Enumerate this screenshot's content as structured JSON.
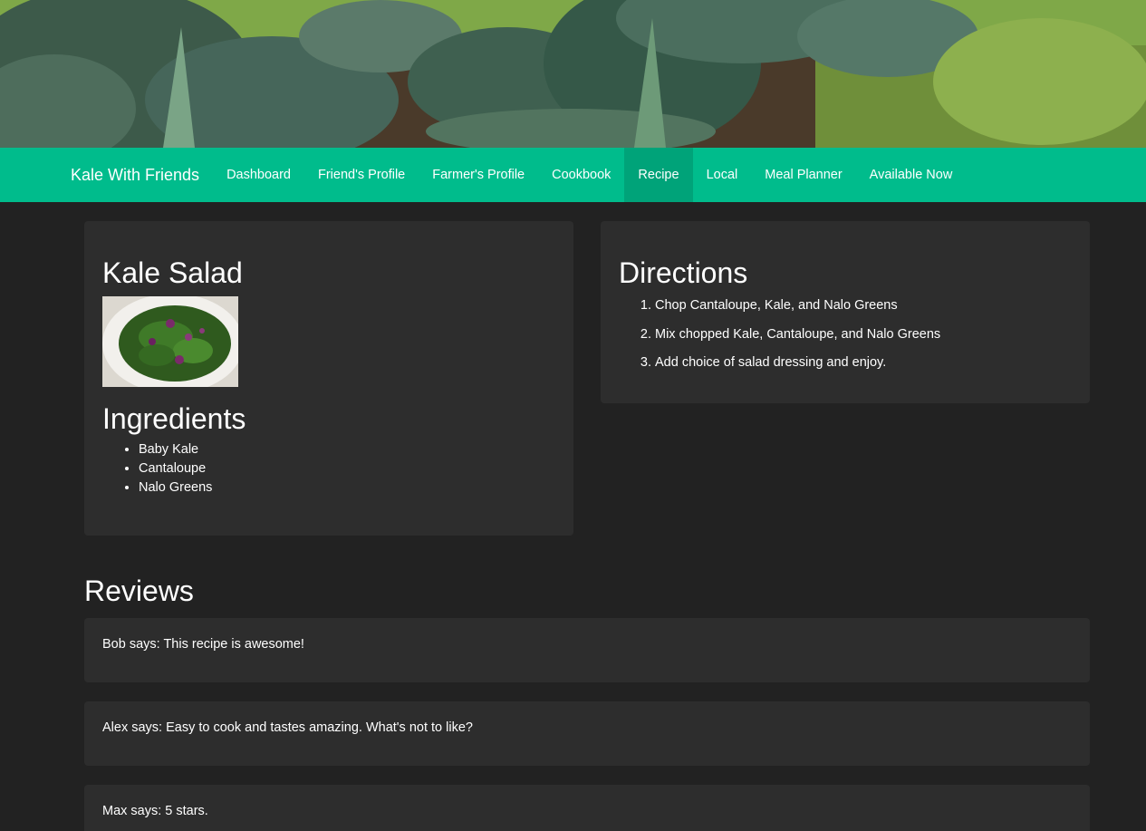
{
  "navbar": {
    "brand": "Kale With Friends",
    "items": [
      {
        "label": "Dashboard"
      },
      {
        "label": "Friend's Profile"
      },
      {
        "label": "Farmer's Profile"
      },
      {
        "label": "Cookbook"
      },
      {
        "label": "Recipe",
        "active": true
      },
      {
        "label": "Local"
      },
      {
        "label": "Meal Planner"
      },
      {
        "label": "Available Now"
      }
    ]
  },
  "recipe": {
    "title": "Kale Salad",
    "image_icon": "salad-photo",
    "ingredients_title": "Ingredients",
    "ingredients": [
      "Baby Kale",
      "Cantaloupe",
      "Nalo Greens"
    ]
  },
  "directions": {
    "title": "Directions",
    "steps": [
      "Chop Cantaloupe, Kale, and Nalo Greens",
      "Mix chopped Kale, Cantaloupe, and Nalo Greens",
      "Add choice of salad dressing and enjoy."
    ]
  },
  "reviews": {
    "title": "Reviews",
    "items": [
      "Bob says: This recipe is awesome!",
      "Alex says: Easy to cook and tastes amazing. What's not to like?",
      "Max says: 5 stars."
    ]
  },
  "colors": {
    "navbar": "#00bc8c",
    "navbar_active": "#00a379",
    "background": "#222222",
    "panel": "#2d2d2d"
  }
}
